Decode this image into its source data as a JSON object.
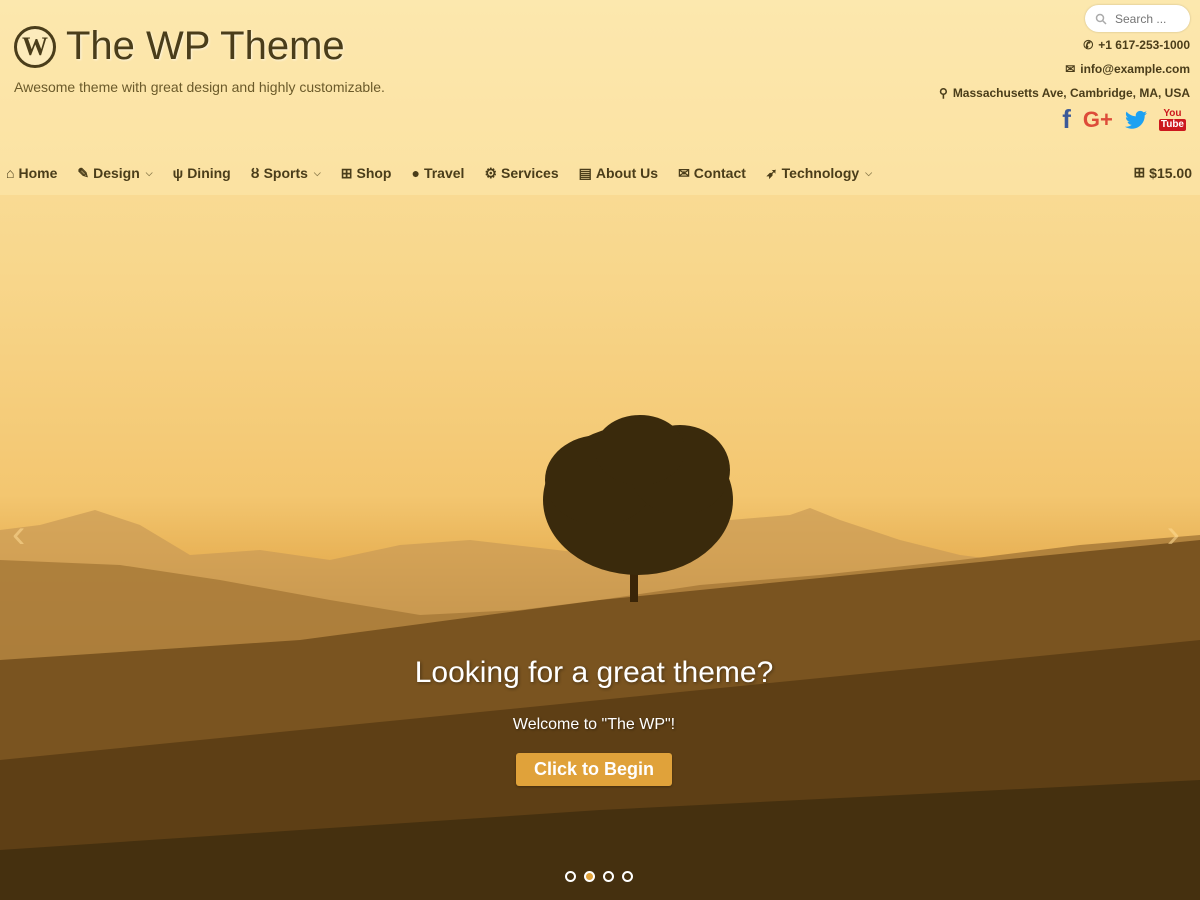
{
  "site": {
    "title": "The WP Theme",
    "tagline": "Awesome theme with great design and highly customizable.",
    "logo_letter": "W"
  },
  "search": {
    "placeholder": "Search ..."
  },
  "contact": {
    "phone": "+1 617-253-1000",
    "email": "info@example.com",
    "address": "Massachusetts Ave, Cambridge, MA, USA"
  },
  "social": {
    "facebook": "f",
    "google": "G+",
    "youtube_top": "You",
    "youtube_bottom": "Tube"
  },
  "nav": {
    "items": [
      {
        "label": "Home",
        "icon": "home-icon",
        "glyph": "⌂"
      },
      {
        "label": "Design",
        "icon": "brush-icon",
        "glyph": "✎",
        "dropdown": true
      },
      {
        "label": "Dining",
        "icon": "cutlery-icon",
        "glyph": "🍴"
      },
      {
        "label": "Sports",
        "icon": "bicycle-icon",
        "glyph": "🚲",
        "dropdown": true
      },
      {
        "label": "Shop",
        "icon": "cart-icon",
        "glyph": "🛒"
      },
      {
        "label": "Travel",
        "icon": "globe-icon",
        "glyph": "🌐"
      },
      {
        "label": "Services",
        "icon": "gear-icon",
        "glyph": "⚙"
      },
      {
        "label": "About Us",
        "icon": "building-icon",
        "glyph": "▤"
      },
      {
        "label": "Contact",
        "icon": "envelope-icon",
        "glyph": "✉"
      },
      {
        "label": "Technology",
        "icon": "rocket-icon",
        "glyph": "➶",
        "dropdown": true
      }
    ],
    "cart_total": "$15.00"
  },
  "slider": {
    "title": "Looking for a great theme?",
    "subtitle": "Welcome to \"The WP\"!",
    "button": "Click to Begin",
    "slide_count": 4,
    "active_index": 1
  },
  "colors": {
    "accent": "#e0a23a",
    "text_dark": "#4a3d1a",
    "facebook": "#3b5998",
    "google": "#dd4b39",
    "twitter": "#1da1f2",
    "youtube": "#cc181e"
  }
}
